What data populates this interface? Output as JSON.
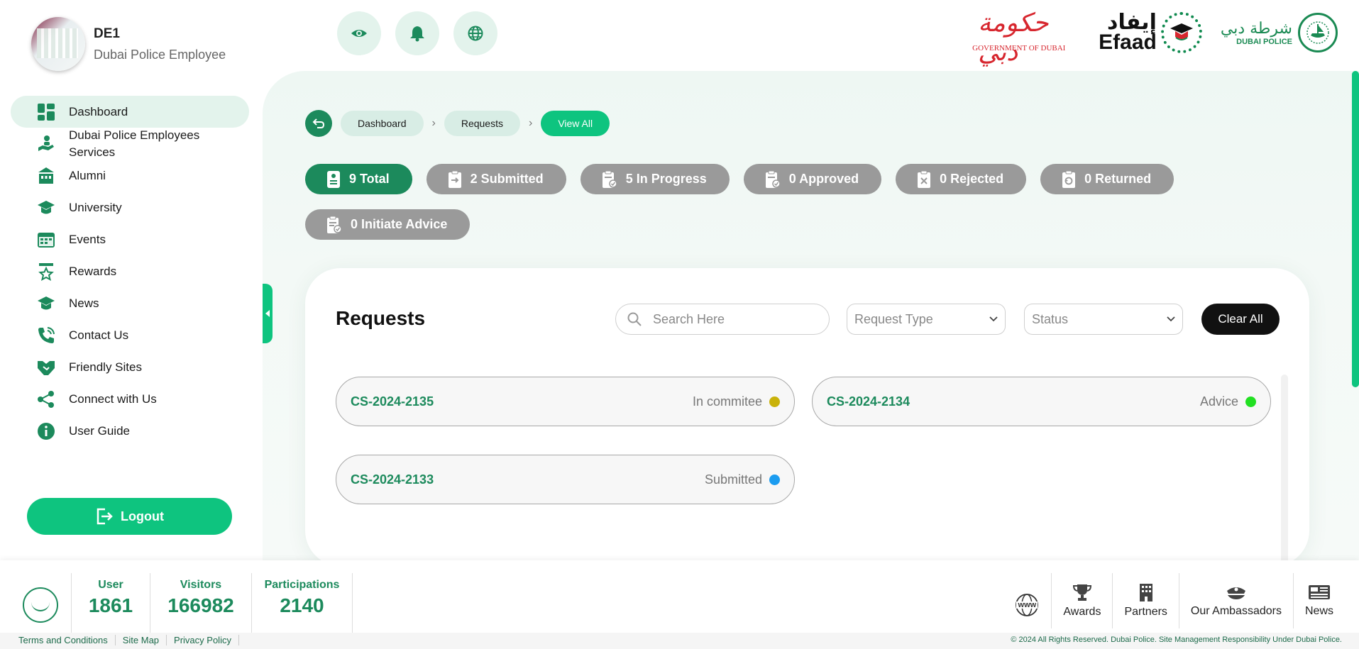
{
  "profile": {
    "name": "DE1",
    "role": "Dubai Police Employee"
  },
  "header": {
    "icons": [
      "eye-icon",
      "bell-icon",
      "globe-icon"
    ],
    "logos": {
      "gov_arabic": "حكومة دبي",
      "gov_english": "GOVERNMENT OF DUBAI",
      "efaad_arabic": "إيفاد",
      "efaad_english": "Efaad",
      "dp_arabic": "شرطة دبي",
      "dp_english": "DUBAI POLICE"
    }
  },
  "sidebar": {
    "items": [
      {
        "label": "Dashboard",
        "icon": "dashboard-icon",
        "active": true
      },
      {
        "label": "Dubai Police Employees Services",
        "icon": "hand-service-icon"
      },
      {
        "label": "Alumni",
        "icon": "building-icon"
      },
      {
        "label": "University",
        "icon": "graduation-cap-icon"
      },
      {
        "label": "Events",
        "icon": "calendar-icon"
      },
      {
        "label": "Rewards",
        "icon": "star-icon"
      },
      {
        "label": "News",
        "icon": "graduation-cap-icon"
      },
      {
        "label": "Contact Us",
        "icon": "phone-icon"
      },
      {
        "label": "Friendly Sites",
        "icon": "handshake-icon"
      },
      {
        "label": "Connect with Us",
        "icon": "share-icon"
      },
      {
        "label": "User Guide",
        "icon": "info-icon"
      }
    ],
    "logout_label": "Logout"
  },
  "breadcrumb": {
    "items": [
      "Dashboard",
      "Requests",
      "View All"
    ]
  },
  "stats": [
    {
      "label": "9 Total",
      "active": true
    },
    {
      "label": "2 Submitted"
    },
    {
      "label": "5 In Progress"
    },
    {
      "label": "0 Approved"
    },
    {
      "label": "0 Rejected"
    },
    {
      "label": "0 Returned"
    },
    {
      "label": "0 Initiate Advice"
    }
  ],
  "requests_panel": {
    "title": "Requests",
    "search_placeholder": "Search Here",
    "request_type_placeholder": "Request Type",
    "status_placeholder": "Status",
    "clear_label": "Clear All",
    "items": [
      {
        "id": "CS-2024-2135",
        "status": "In commitee",
        "color": "#c9b20a"
      },
      {
        "id": "CS-2024-2134",
        "status": "Advice",
        "color": "#22e022"
      },
      {
        "id": "CS-2024-2133",
        "status": "Submitted",
        "color": "#1b9cf0"
      }
    ]
  },
  "footer": {
    "counters": [
      {
        "label": "User",
        "value": "1861"
      },
      {
        "label": "Visitors",
        "value": "166982"
      },
      {
        "label": "Participations",
        "value": "2140"
      }
    ],
    "www_label": "www",
    "links": [
      {
        "label": "Awards",
        "icon": "trophy-icon"
      },
      {
        "label": "Partners",
        "icon": "office-building-icon"
      },
      {
        "label": "Our Ambassadors",
        "icon": "police-cap-icon"
      },
      {
        "label": "News",
        "icon": "newspaper-icon"
      }
    ],
    "legal": [
      "Terms and Conditions",
      "Site Map",
      "Privacy Policy"
    ],
    "copyright": "© 2024 All Rights Reserved. Dubai Police. Site Management Responsibility Under Dubai Police."
  }
}
